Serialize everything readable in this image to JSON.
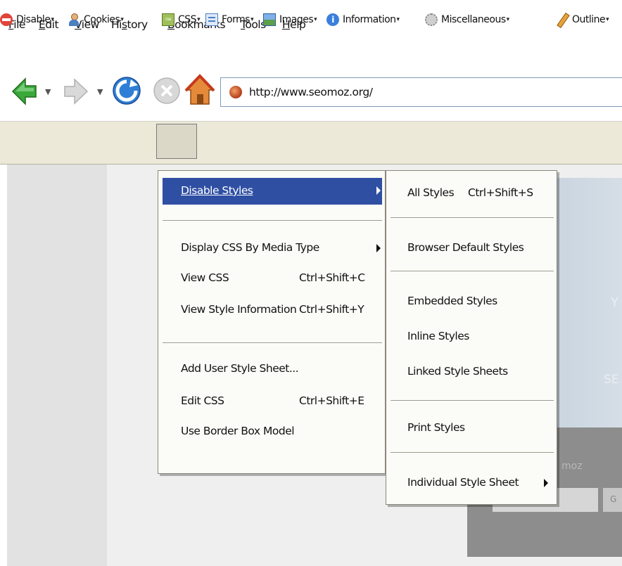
{
  "menubar": {
    "items": [
      {
        "label": "File"
      },
      {
        "label": "Edit"
      },
      {
        "label": "View"
      },
      {
        "label": "History"
      },
      {
        "label": "Bookmarks"
      },
      {
        "label": "Tools"
      },
      {
        "label": "Help"
      }
    ]
  },
  "navbar": {
    "back_icon": "back-arrow-icon",
    "forward_icon": "forward-arrow-icon",
    "reload_icon": "reload-icon",
    "stop_icon": "stop-icon",
    "home_icon": "home-icon",
    "url": "http://www.seomoz.org/",
    "colors": {
      "back": "#3aa83a",
      "reload": "#2f7fd6",
      "home": "#e0722c"
    }
  },
  "devbar": {
    "items": [
      {
        "label": "Disable",
        "icon": "no-entry-icon"
      },
      {
        "label": "Cookies",
        "icon": "person-icon"
      },
      {
        "label": "CSS",
        "icon": "css-icon"
      },
      {
        "label": "Forms",
        "icon": "form-icon"
      },
      {
        "label": "Images",
        "icon": "image-icon"
      },
      {
        "label": "Information",
        "icon": "info-icon"
      },
      {
        "label": "Miscellaneous",
        "icon": "gear-icon"
      },
      {
        "label": "Outline",
        "icon": "pencil-icon"
      }
    ]
  },
  "css_menu": {
    "disable_styles": "Disable Styles",
    "display_by_media": "Display CSS By Media Type",
    "view_css": "View CSS",
    "view_css_shortcut": "Ctrl+Shift+C",
    "view_style_info": "View Style Information",
    "view_style_info_shortcut": "Ctrl+Shift+Y",
    "add_user_sheet": "Add User Style Sheet...",
    "edit_css": "Edit CSS",
    "edit_css_shortcut": "Ctrl+Shift+E",
    "border_box": "Use Border Box Model",
    "highlight_color": "#2f4fa3"
  },
  "disable_submenu": {
    "all_styles": "All Styles",
    "all_styles_shortcut": "Ctrl+Shift+S",
    "browser_default": "Browser Default Styles",
    "embedded": "Embedded Styles",
    "inline": "Inline Styles",
    "linked": "Linked Style Sheets",
    "print": "Print Styles",
    "individual": "Individual Style Sheet"
  },
  "page": {
    "ghost_y": "Y",
    "ghost_se": "SE",
    "ghost_moz": "moz",
    "ghost_go": "G"
  }
}
